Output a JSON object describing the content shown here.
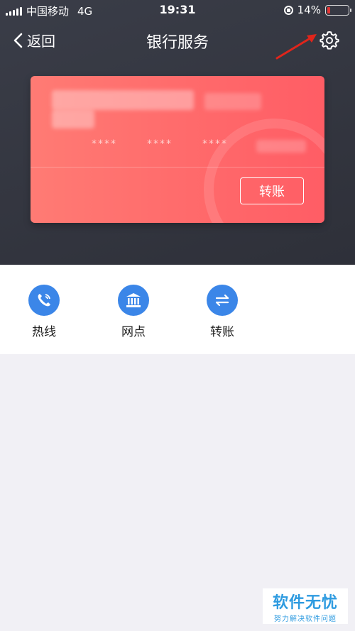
{
  "status_bar": {
    "carrier": "中国移动",
    "network": "4G",
    "time": "19:31",
    "battery": "14%",
    "battery_level": 0.14,
    "battery_color": "#e33333"
  },
  "nav": {
    "back_label": "返回",
    "title": "银行服务",
    "settings_icon": "gear-icon"
  },
  "card": {
    "masked_number": [
      "****",
      "****",
      "****"
    ],
    "transfer_label": "转账",
    "gradient_start": "#ff7b74",
    "gradient_end": "#ff5d65"
  },
  "services": [
    {
      "label": "热线",
      "icon": "phone-icon"
    },
    {
      "label": "网点",
      "icon": "bank-icon"
    },
    {
      "label": "转账",
      "icon": "transfer-icon"
    }
  ],
  "watermark": {
    "line1": "软件无忧",
    "line2": "努力解决软件问题"
  },
  "colors": {
    "header_bg": "#33363f",
    "accent_blue": "#3b86e8",
    "annotation_red": "#e0251b"
  }
}
